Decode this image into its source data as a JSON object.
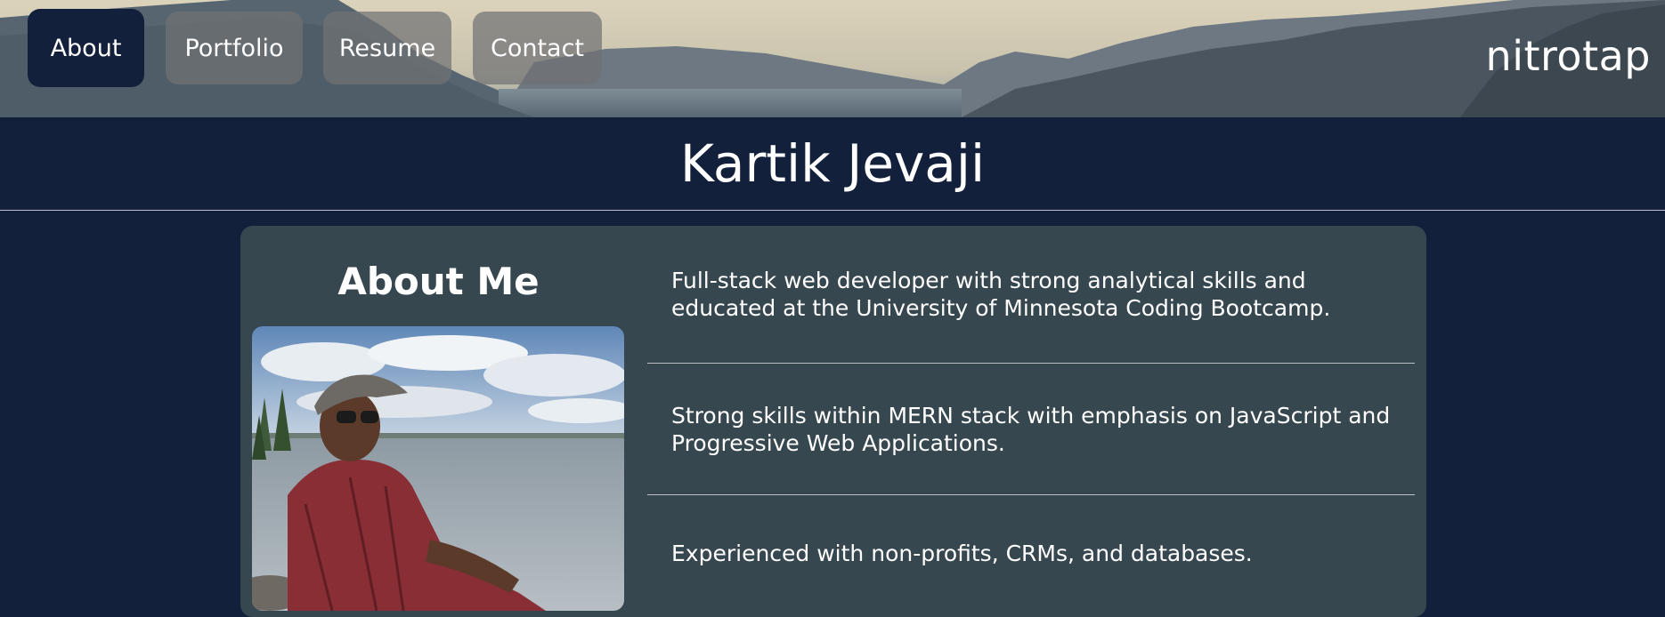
{
  "nav": {
    "items": [
      {
        "label": "About",
        "active": true
      },
      {
        "label": "Portfolio",
        "active": false
      },
      {
        "label": "Resume",
        "active": false
      },
      {
        "label": "Contact",
        "active": false
      }
    ]
  },
  "brand": "nitrotap",
  "hero": {
    "name": "Kartik Jevaji"
  },
  "about": {
    "heading": "About Me",
    "bio": [
      "Full-stack web developer with strong analytical skills and educated at the University of Minnesota Coding Bootcamp.",
      "Strong skills within MERN stack with emphasis on JavaScript and Progressive Web Applications.",
      "Experienced with non-profits, CRMs, and databases."
    ]
  },
  "colors": {
    "page_bg": "#13203b",
    "card_bg": "#37474f",
    "active_tab": "#13203b",
    "idle_tab": "#707274"
  }
}
